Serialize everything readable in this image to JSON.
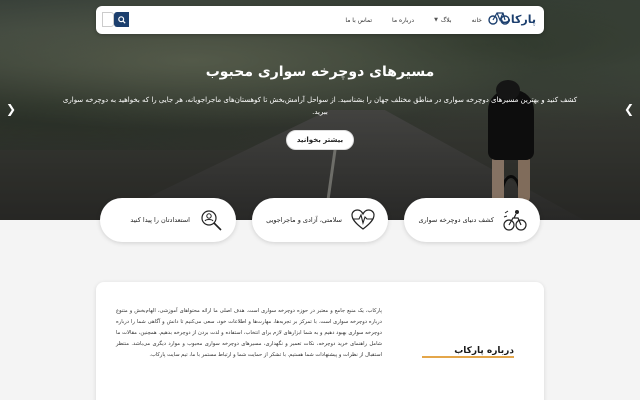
{
  "brand": {
    "logo_text": "پارکاب",
    "primary_color": "#1c3f6e",
    "accent_color": "#e4a64a"
  },
  "nav": {
    "items": [
      {
        "label": "خانه",
        "has_dropdown": false
      },
      {
        "label": "بلاگ",
        "has_dropdown": true
      },
      {
        "label": "درباره ما",
        "has_dropdown": false
      },
      {
        "label": "تماس با ما",
        "has_dropdown": false
      }
    ],
    "search_icon": "search-icon"
  },
  "hero": {
    "title": "مسیرهای دوچرخه سواری محبوب",
    "description": "کشف کنید و بهترین مسیرهای دوچرخه سواری در مناطق مختلف جهان را بشناسید. از سواحل آرامش‌بخش تا کوهستان‌های ماجراجویانه، هر جایی را که بخواهید به دوچرخه سواری ببرید.",
    "button_label": "بیشتر بخوانید"
  },
  "features": [
    {
      "label": "کشف دنیای دوچرخه سواری",
      "icon": "cyclist-icon"
    },
    {
      "label": "سلامتی، آزادی و ماجراجویی",
      "icon": "heartbeat-icon"
    },
    {
      "label": "استعدادتان را پیدا کنید",
      "icon": "talent-search-icon"
    }
  ],
  "about": {
    "heading": "درباره پارکاب",
    "text": "پارکاب، یک منبع جامع و معتبر در حوزه دوچرخه سواری است. هدف اصلی ما ارائه محتواهای آموزشی، الهام‌بخش و متنوع درباره دوچرخه سواری است. با تمرکز بر تجربه‌ها، مهارت‌ها و اطلاعات خود، سعی می‌کنیم تا دانش و آگاهی شما را درباره دوچرخه سواری بهبود دهیم و به شما ابزارهای لازم برای انتخاب، استفاده و لذت بردن از دوچرخه بدهیم. همچنین، مقالات ما شامل راهنمای خرید دوچرخه، نکات تعمیر و نگهداری، مسیرهای دوچرخه سواری محبوب و موارد دیگری می‌باشد. منتظر استقبال از نظرات و پیشنهادات شما هستیم. با تشکر از حمایت شما و ارتباط مستمر با ما، تیم سایت پارکاب."
  }
}
